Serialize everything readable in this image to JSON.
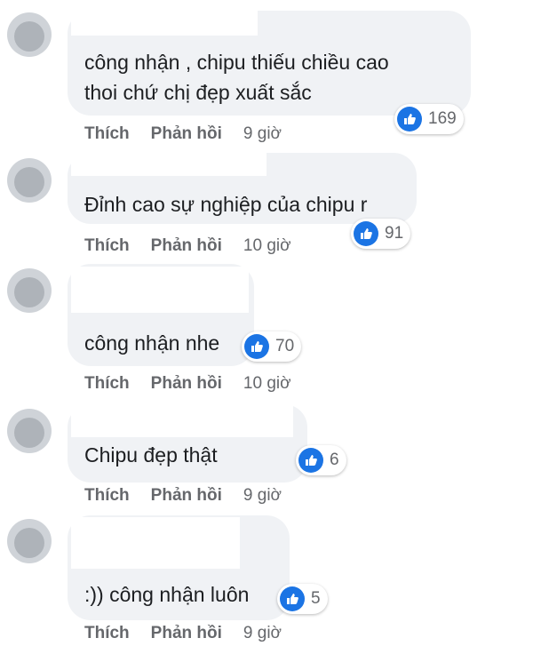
{
  "comments": [
    {
      "text_lines": [
        "công nhận , chipu thiếu chiều cao",
        "thoi chứ chị đẹp xuất sắc"
      ],
      "likes": "169",
      "like_label": "Thích",
      "reply_label": "Phản hồi",
      "time": "9 giờ"
    },
    {
      "text_lines": [
        "Đỉnh cao sự nghiệp của chipu r"
      ],
      "likes": "91",
      "like_label": "Thích",
      "reply_label": "Phản hồi",
      "time": "10 giờ"
    },
    {
      "text_lines": [
        "công nhận nhe"
      ],
      "likes": "70",
      "like_label": "Thích",
      "reply_label": "Phản hồi",
      "time": "10 giờ"
    },
    {
      "text_lines": [
        "Chipu đẹp thật"
      ],
      "likes": "6",
      "like_label": "Thích",
      "reply_label": "Phản hồi",
      "time": "9 giờ"
    },
    {
      "text_lines": [
        ":)) công nhận luôn"
      ],
      "likes": "5",
      "like_label": "Thích",
      "reply_label": "Phản hồi",
      "time": "9 giờ"
    }
  ],
  "colors": {
    "bubble": "#f0f2f5",
    "like_blue": "#1b74e4",
    "meta_text": "#65676b"
  },
  "icons": {
    "reaction": "like-thumb-icon",
    "avatar": "avatar-redacted"
  }
}
